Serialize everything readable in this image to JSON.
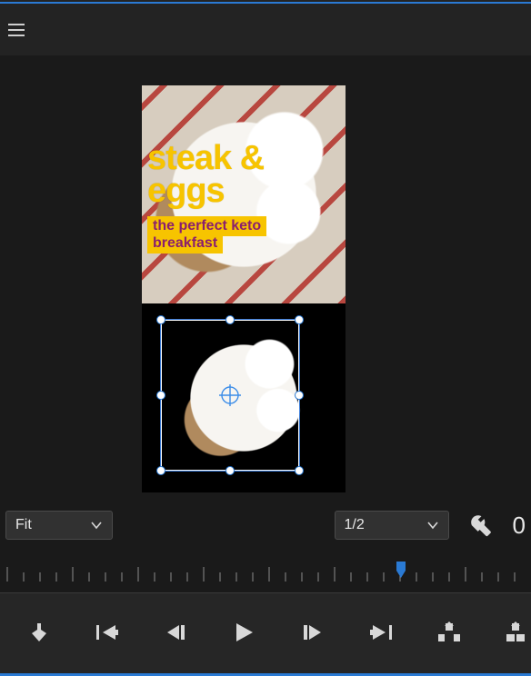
{
  "header": {
    "menu_icon": "hamburger-icon"
  },
  "monitor": {
    "title_line1": "steak &",
    "title_line2": "eggs",
    "subtitle_line1": "the perfect keto",
    "subtitle_line2": "breakfast"
  },
  "controls": {
    "zoom_label": "Fit",
    "resolution_label": "1/2",
    "timecode_fragment": "0"
  },
  "transport": {
    "mark_in": "mark-in",
    "go_in": "go-to-in",
    "step_back": "step-back",
    "play": "play",
    "step_fwd": "step-forward",
    "go_out": "go-to-out",
    "lift": "lift",
    "extract": "extract"
  },
  "colors": {
    "accent": "#2a7ad4",
    "title": "#f7c400",
    "subtitle_bg": "#f7c400",
    "subtitle_fg": "#8a1f6e"
  }
}
